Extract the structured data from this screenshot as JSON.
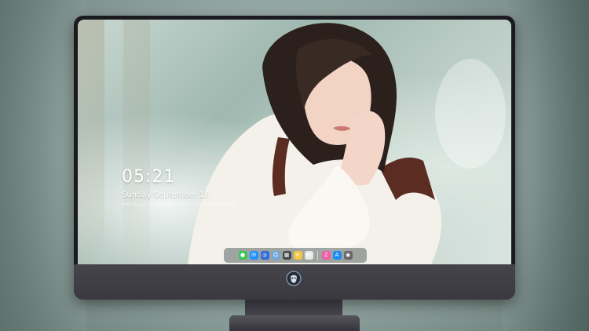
{
  "lockscreen": {
    "time": "05:21",
    "date": "Sunday September 18",
    "caption": "Alinks Naurayrarulin.a Surdeey, naturairuauren Jaraf Jaran la aigar"
  },
  "dock": {
    "apps": [
      {
        "icon": "messages-icon",
        "glyph": "●",
        "color": "#34c759"
      },
      {
        "icon": "mail-icon",
        "glyph": "✉",
        "color": "#1e90ff"
      },
      {
        "icon": "safari-icon",
        "glyph": "◎",
        "color": "#2e6bd8"
      },
      {
        "icon": "finder-icon",
        "glyph": "☺",
        "color": "#6fa8dc"
      },
      {
        "icon": "claquette-icon",
        "glyph": "▦",
        "color": "#444444"
      },
      {
        "icon": "notes-icon",
        "glyph": "≡",
        "color": "#f5c542"
      },
      {
        "icon": "photos-icon",
        "glyph": "✿",
        "color": "#e8e8e8"
      },
      {
        "icon": "music-icon",
        "glyph": "♫",
        "color": "#f05fa8"
      },
      {
        "icon": "app-store-icon",
        "glyph": "A",
        "color": "#1b8cf5"
      },
      {
        "icon": "camera-icon",
        "glyph": "◉",
        "color": "#666666"
      }
    ]
  },
  "colors": {
    "monitor_bezel": "#1b1b1f",
    "chin": "#45444b",
    "accent": "#34c759"
  }
}
